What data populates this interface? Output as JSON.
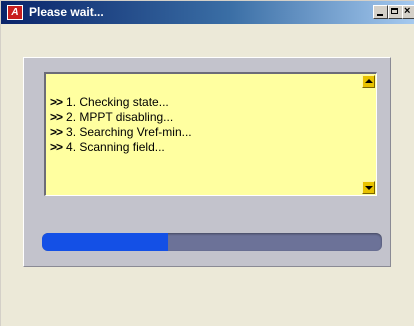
{
  "window": {
    "title": "Please wait...",
    "icon": "app-logo-icon",
    "icon_text": "Af"
  },
  "log": {
    "prefix": ">>",
    "lines": [
      "1. Checking state...",
      "2. MPPT disabling...",
      "3. Searching Vref-min...",
      "4. Scanning field..."
    ]
  },
  "progress": {
    "fraction": 0.37,
    "fill_color": "#1450e6",
    "track_color": "#6c7298"
  },
  "colors": {
    "log_background": "#ffffa0",
    "panel_background": "#c3c3cc",
    "scroll_button": "#e8c200"
  }
}
